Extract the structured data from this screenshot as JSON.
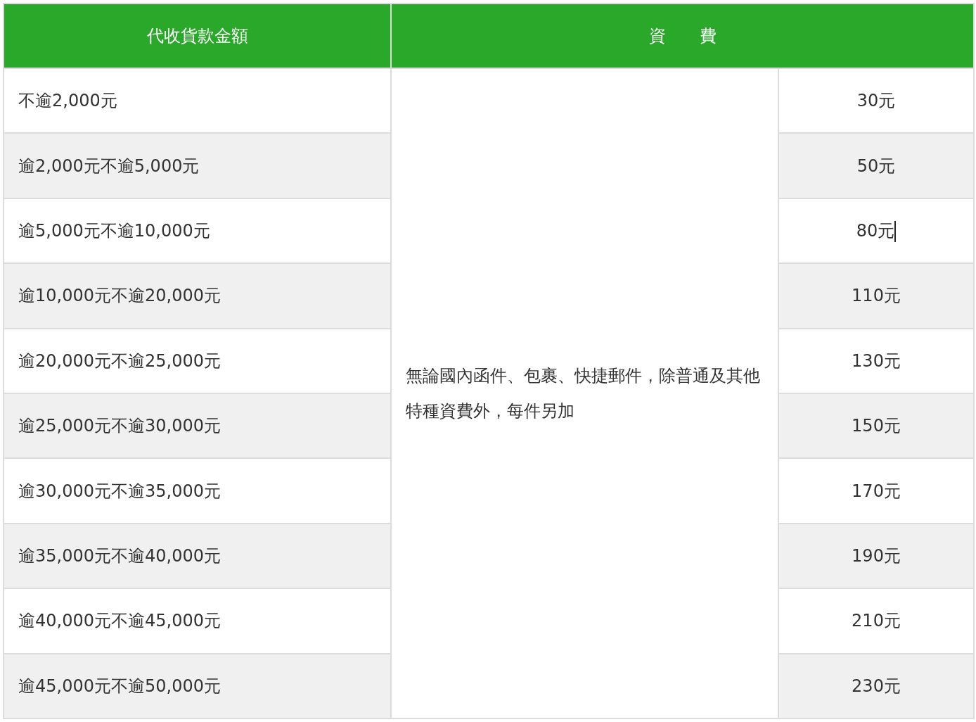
{
  "table": {
    "columns": [
      "代收貨款金額",
      "資　　費"
    ],
    "note": "無論國內函件、包裹、快捷郵件，除普通及其他特種資費外，每件另加",
    "rows": [
      {
        "amount": "不逾2,000元",
        "fee": "30元"
      },
      {
        "amount": "逾2,000元不逾5,000元",
        "fee": "50元"
      },
      {
        "amount": "逾5,000元不逾10,000元",
        "fee": "80元",
        "cursor": true
      },
      {
        "amount": "逾10,000元不逾20,000元",
        "fee": "110元"
      },
      {
        "amount": "逾20,000元不逾25,000元",
        "fee": "130元"
      },
      {
        "amount": "逾25,000元不逾30,000元",
        "fee": "150元"
      },
      {
        "amount": "逾30,000元不逾35,000元",
        "fee": "170元"
      },
      {
        "amount": "逾35,000元不逾40,000元",
        "fee": "190元"
      },
      {
        "amount": "逾40,000元不逾45,000元",
        "fee": "210元"
      },
      {
        "amount": "逾45,000元不逾50,000元",
        "fee": "230元"
      }
    ]
  }
}
